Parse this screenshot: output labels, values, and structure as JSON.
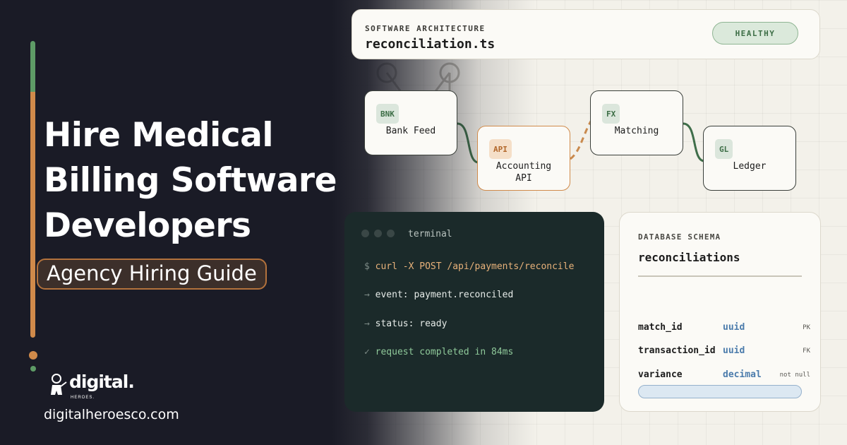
{
  "left": {
    "headline": [
      "Hire Medical",
      "Billing Software",
      "Developers"
    ],
    "subtitle": "Agency Hiring Guide",
    "brand": {
      "name": "digital.",
      "sub": "HEROES.",
      "website": "digitalheroesco.com"
    },
    "colors": {
      "accent_green": "#5e9b66",
      "accent_orange": "#d08a4a",
      "background": "#1a1b26"
    }
  },
  "header": {
    "eyebrow": "SOFTWARE ARCHITECTURE",
    "file": "reconciliation.ts",
    "status_badge": "HEALTHY"
  },
  "nodes": [
    {
      "tag": "BNK",
      "label": "Bank Feed"
    },
    {
      "tag": "API",
      "label_lines": [
        "Accounting",
        "API"
      ]
    },
    {
      "tag": "FX",
      "label": "Matching"
    },
    {
      "tag": "GL",
      "label": "Ledger"
    }
  ],
  "terminal": {
    "title": "terminal",
    "lines": [
      {
        "prefix": "$",
        "text": "curl -X POST /api/payments/reconcile"
      },
      {
        "prefix": "→",
        "text": "event: payment.reconciled"
      },
      {
        "prefix": "→",
        "text": "status: ready"
      },
      {
        "prefix": "✓",
        "text": "request completed in 84ms"
      }
    ]
  },
  "schema": {
    "eyebrow": "DATABASE SCHEMA",
    "table": "reconciliations",
    "rows": [
      {
        "name": "match_id",
        "type": "uuid",
        "flag": "PK"
      },
      {
        "name": "transaction_id",
        "type": "uuid",
        "flag": "FK"
      },
      {
        "name": "variance",
        "type": "decimal",
        "flag": "not null"
      }
    ]
  }
}
